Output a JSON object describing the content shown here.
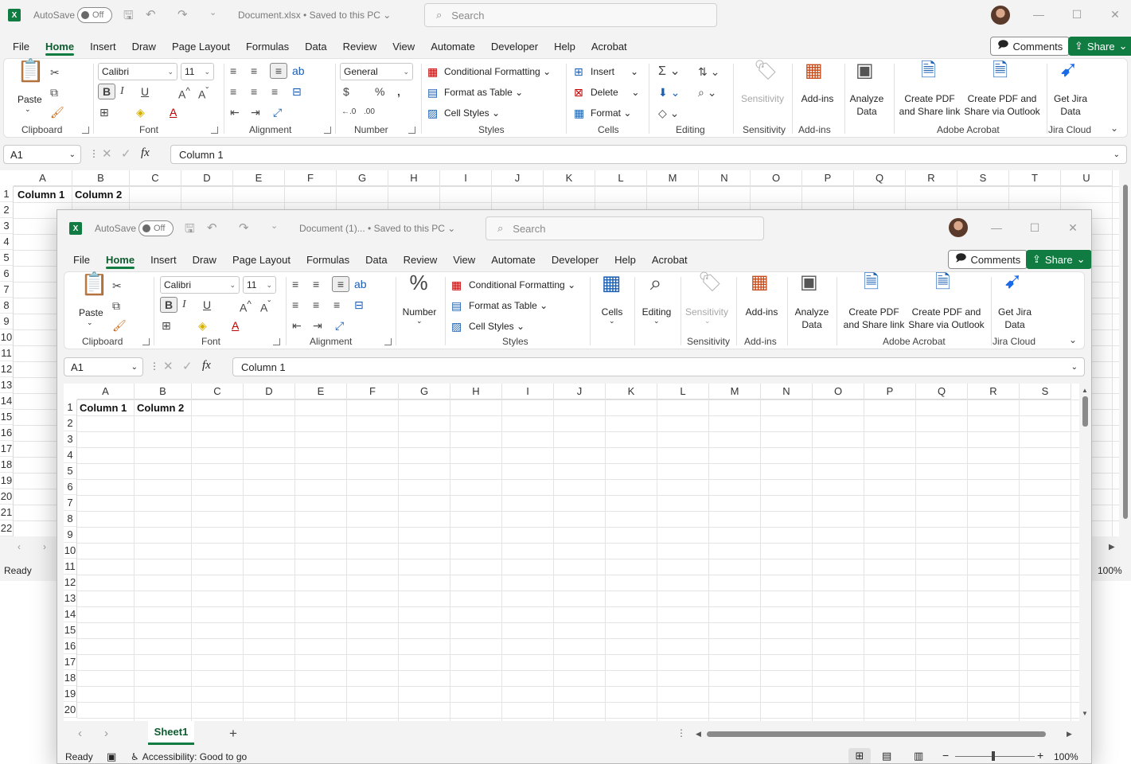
{
  "back_window": {
    "title": {
      "autosave": "AutoSave",
      "toggle": "Off",
      "doc": "Document.xlsx",
      "saved": "Saved to this PC",
      "search_placeholder": "Search"
    },
    "menu_tabs": [
      "File",
      "Home",
      "Insert",
      "Draw",
      "Page Layout",
      "Formulas",
      "Data",
      "Review",
      "View",
      "Automate",
      "Developer",
      "Help",
      "Acrobat"
    ],
    "comments": "Comments",
    "share": "Share",
    "ribbon": {
      "paste": "Paste",
      "clipboard": "Clipboard",
      "font_name": "Calibri",
      "font_size": "11",
      "font": "Font",
      "alignment": "Alignment",
      "number_format": "General",
      "number": "Number",
      "conditional_formatting": "Conditional Formatting",
      "format_as_table": "Format as Table",
      "cell_styles": "Cell Styles",
      "styles": "Styles",
      "insert": "Insert",
      "delete": "Delete",
      "format": "Format",
      "cells": "Cells",
      "editing": "Editing",
      "sensitivity": "Sensitivity",
      "addins": "Add-ins",
      "analyze_1": "Analyze",
      "analyze_2": "Data",
      "create_pdf_1": "Create PDF",
      "create_pdf_2": "and Share link",
      "create_pdf_outlook_1": "Create PDF and",
      "create_pdf_outlook_2": "Share via Outlook",
      "adobe_acrobat": "Adobe Acrobat",
      "jira_1": "Get Jira",
      "jira_2": "Data",
      "jira_cloud": "Jira Cloud"
    },
    "name_box": "A1",
    "formula": "Column 1",
    "columns": [
      "A",
      "B",
      "C",
      "D",
      "E",
      "F",
      "G",
      "H",
      "I",
      "J",
      "K",
      "L",
      "M",
      "N",
      "O",
      "P",
      "Q",
      "R",
      "S",
      "T",
      "U"
    ],
    "rows": [
      "1",
      "2",
      "3",
      "4",
      "5",
      "6",
      "7",
      "8",
      "9",
      "10",
      "11",
      "12",
      "13",
      "14",
      "15",
      "16",
      "17",
      "18",
      "19",
      "20",
      "21",
      "22"
    ],
    "a1": "Column 1",
    "b1": "Column 2",
    "status_ready": "Ready",
    "zoom": "100%"
  },
  "front_window": {
    "title": {
      "autosave": "AutoSave",
      "toggle": "Off",
      "doc": "Document (1)...",
      "saved": "Saved to this PC",
      "search_placeholder": "Search"
    },
    "menu_tabs": [
      "File",
      "Home",
      "Insert",
      "Draw",
      "Page Layout",
      "Formulas",
      "Data",
      "Review",
      "View",
      "Automate",
      "Developer",
      "Help",
      "Acrobat"
    ],
    "comments": "Comments",
    "share": "Share",
    "ribbon": {
      "paste": "Paste",
      "clipboard": "Clipboard",
      "font_name": "Calibri",
      "font_size": "11",
      "font": "Font",
      "alignment": "Alignment",
      "number": "Number",
      "conditional_formatting": "Conditional Formatting",
      "format_as_table": "Format as Table",
      "cell_styles": "Cell Styles",
      "styles": "Styles",
      "cells": "Cells",
      "editing": "Editing",
      "sensitivity": "Sensitivity",
      "addins": "Add-ins",
      "analyze_1": "Analyze",
      "analyze_2": "Data",
      "create_pdf_1": "Create PDF",
      "create_pdf_2": "and Share link",
      "create_pdf_outlook_1": "Create PDF and",
      "create_pdf_outlook_2": "Share via Outlook",
      "adobe_acrobat": "Adobe Acrobat",
      "jira_1": "Get Jira",
      "jira_2": "Data",
      "jira_cloud": "Jira Cloud"
    },
    "name_box": "A1",
    "formula": "Column 1",
    "columns": [
      "A",
      "B",
      "C",
      "D",
      "E",
      "F",
      "G",
      "H",
      "I",
      "J",
      "K",
      "L",
      "M",
      "N",
      "O",
      "P",
      "Q",
      "R",
      "S"
    ],
    "rows": [
      "1",
      "2",
      "3",
      "4",
      "5",
      "6",
      "7",
      "8",
      "9",
      "10",
      "11",
      "12",
      "13",
      "14",
      "15",
      "16",
      "17",
      "18",
      "19",
      "20"
    ],
    "a1": "Column 1",
    "b1": "Column 2",
    "sheet_tab": "Sheet1",
    "status_ready": "Ready",
    "accessibility": "Accessibility: Good to go",
    "zoom": "100%"
  }
}
